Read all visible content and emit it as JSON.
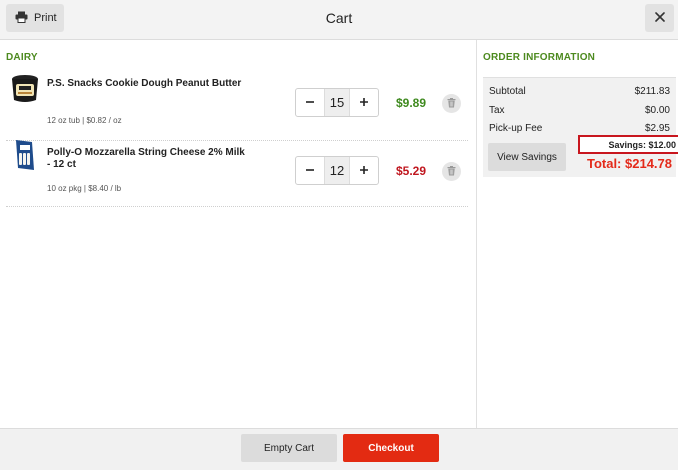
{
  "header": {
    "print_label": "Print",
    "title": "Cart"
  },
  "section": {
    "title": "DAIRY"
  },
  "items": [
    {
      "name": "P.S. Snacks Cookie Dough Peanut Butter",
      "meta": "12 oz tub | $0.82 / oz",
      "quantity": "15",
      "price": "$9.89",
      "price_color": "#3f8a1f"
    },
    {
      "name": "Polly-O Mozzarella String Cheese 2% Milk - 12 ct",
      "meta": "10 oz pkg | $8.40 / lb",
      "quantity": "12",
      "price": "$5.29",
      "price_color": "#c0171f"
    }
  ],
  "order": {
    "title": "ORDER INFORMATION",
    "subtotal_label": "Subtotal",
    "subtotal_value": "$211.83",
    "tax_label": "Tax",
    "tax_value": "$0.00",
    "pickup_label": "Pick-up Fee",
    "pickup_value": "$2.95",
    "view_savings_label": "View Savings",
    "savings_text": "Savings: $12.00",
    "total_text": "Total: $214.78"
  },
  "footer": {
    "empty_label": "Empty Cart",
    "checkout_label": "Checkout"
  },
  "colors": {
    "accent_green": "#4d8a1f",
    "checkout_red": "#e32b12",
    "highlight_red": "#c8161e"
  }
}
